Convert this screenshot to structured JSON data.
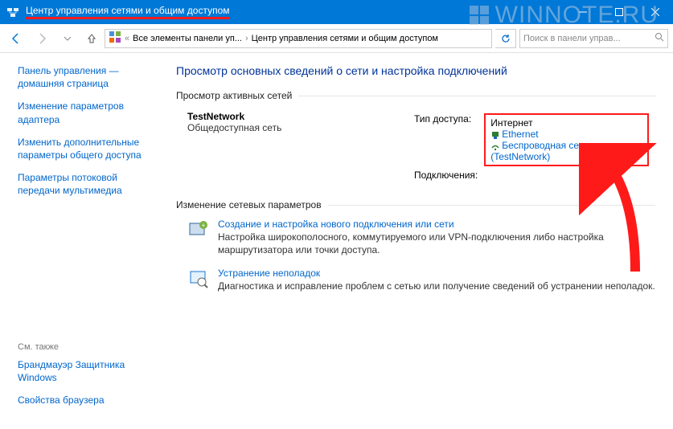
{
  "titlebar": {
    "title": "Центр управления сетями и общим доступом"
  },
  "breadcrumb": {
    "root_icon": "control-panel",
    "item1": "Все элементы панели уп...",
    "item2": "Центр управления сетями и общим доступом"
  },
  "search": {
    "placeholder": "Поиск в панели управ..."
  },
  "sidebar": {
    "items": [
      "Панель управления — домашняя страница",
      "Изменение параметров адаптера",
      "Изменить дополнительные параметры общего доступа",
      "Параметры потоковой передачи мультимедиа"
    ],
    "see_also_label": "См. также",
    "see_also": [
      "Брандмауэр Защитника Windows",
      "Свойства браузера"
    ]
  },
  "main": {
    "page_title": "Просмотр основных сведений о сети и настройка подключений",
    "active_networks_header": "Просмотр активных сетей",
    "network": {
      "name": "TestNetwork",
      "type": "Общедоступная сеть",
      "access_label": "Тип доступа:",
      "access_value": "Интернет",
      "conn_label": "Подключения:",
      "conn1": "Ethernet",
      "conn2": "Беспроводная сеть (TestNetwork)"
    },
    "change_settings_header": "Изменение сетевых параметров",
    "tasks": [
      {
        "title": "Создание и настройка нового подключения или сети",
        "desc": "Настройка широкополосного, коммутируемого или VPN-подключения либо настройка маршрутизатора или точки доступа."
      },
      {
        "title": "Устранение неполадок",
        "desc": "Диагностика и исправление проблем с сетью или получение сведений об устранении неполадок."
      }
    ]
  },
  "watermark": "WINNOTE.RU"
}
